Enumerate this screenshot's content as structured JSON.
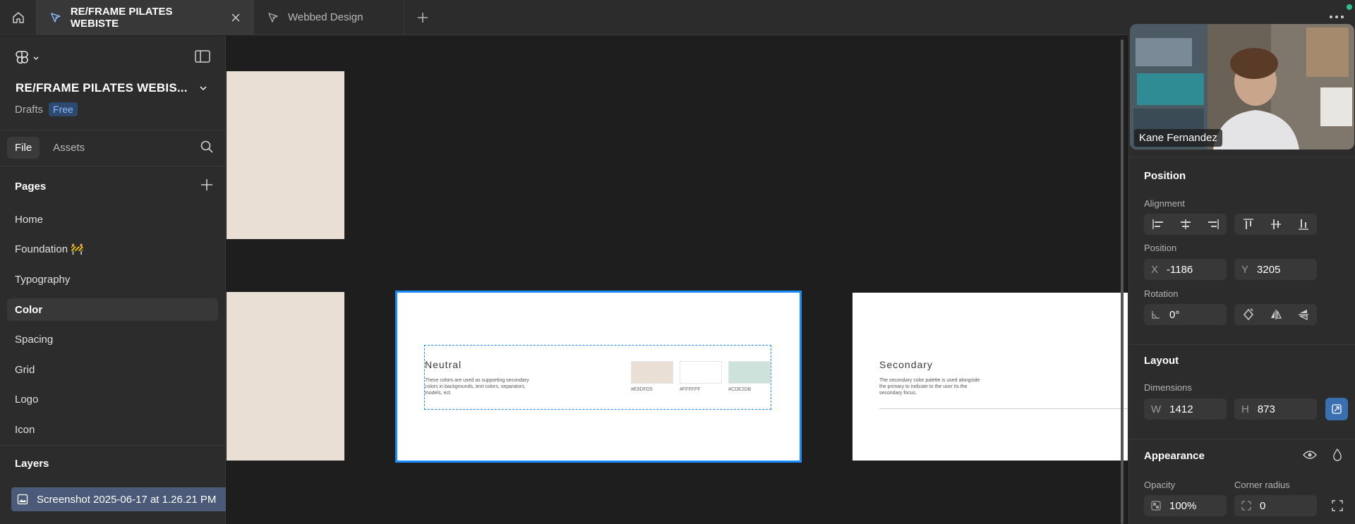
{
  "tabs": [
    {
      "label": "RE/FRAME PILATES WEBISTE"
    },
    {
      "label": "Webbed Design"
    }
  ],
  "left": {
    "project_title": "RE/FRAME PILATES WEBIS...",
    "drafts_label": "Drafts",
    "plan_badge": "Free",
    "file_tab": "File",
    "assets_tab": "Assets",
    "pages_header": "Pages",
    "pages": [
      {
        "label": "Home"
      },
      {
        "label": "Foundation 🚧"
      },
      {
        "label": "Typography"
      },
      {
        "label": "Color"
      },
      {
        "label": "Spacing"
      },
      {
        "label": "Grid"
      },
      {
        "label": "Logo"
      },
      {
        "label": "Icon"
      }
    ],
    "layers_header": "Layers",
    "layer_item": "Screenshot 2025-06-17 at 1.26.21 PM"
  },
  "canvas": {
    "neutral": {
      "heading": "Neutral",
      "desc": "These colors are used as supporting secondary colors in backgrounds, text colors, separators, models, ect.",
      "swatches": [
        {
          "hex": "#E9DFD5",
          "label": "#E9DFD5"
        },
        {
          "hex": "#FFFFFF",
          "label": "#FFFFFF"
        },
        {
          "hex": "#CDE2DB",
          "label": "#CDE2DB"
        }
      ]
    },
    "secondary": {
      "heading": "Secondary",
      "desc": "The secondary color palette is used alongside the primary to indicate to the user its the secondary focus."
    }
  },
  "right": {
    "participant_name": "Kane Fernandez",
    "position_header": "Position",
    "alignment_label": "Alignment",
    "position_label": "Position",
    "x_prefix": "X",
    "x_value": "-1186",
    "y_prefix": "Y",
    "y_value": "3205",
    "rotation_label": "Rotation",
    "rotation_value": "0°",
    "layout_header": "Layout",
    "dimensions_label": "Dimensions",
    "w_prefix": "W",
    "w_value": "1412",
    "h_prefix": "H",
    "h_value": "873",
    "appearance_header": "Appearance",
    "opacity_label": "Opacity",
    "opacity_value": "100%",
    "corner_label": "Corner radius",
    "corner_value": "0"
  },
  "colors": {
    "selection": "#1a8cff",
    "beige": "#E9DFD5",
    "mint": "#CDE2DB",
    "free_badge": "#8cb8ff"
  }
}
